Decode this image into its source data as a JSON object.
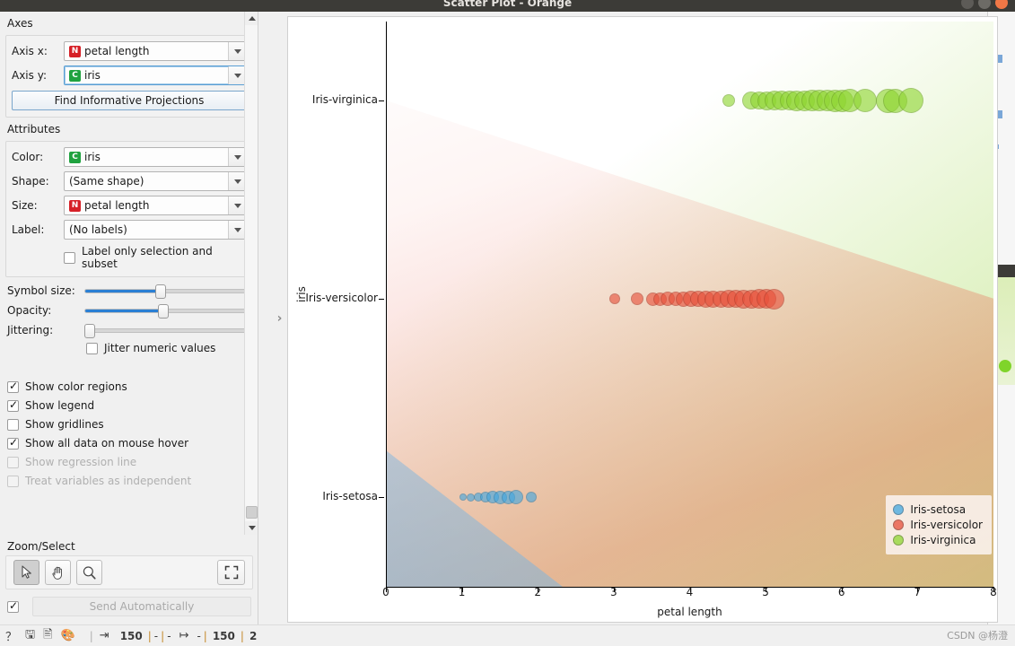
{
  "window": {
    "title": "Scatter Plot - Orange",
    "buttons": {
      "minimize": "minimize",
      "maximize": "maximize",
      "close": "close"
    }
  },
  "panel": {
    "axes": {
      "title": "Axes",
      "axis_x_label": "Axis x:",
      "axis_x_value": "petal length",
      "axis_x_type": "N",
      "axis_y_label": "Axis y:",
      "axis_y_value": "iris",
      "axis_y_type": "C",
      "find_projections_button": "Find Informative Projections"
    },
    "attributes": {
      "title": "Attributes",
      "color_label": "Color:",
      "color_value": "iris",
      "color_type": "C",
      "shape_label": "Shape:",
      "shape_value": "(Same shape)",
      "size_label": "Size:",
      "size_value": "petal length",
      "size_type": "N",
      "label_label": "Label:",
      "label_value": "(No labels)",
      "label_only_selection": "Label only selection and subset",
      "label_only_selection_checked": false
    },
    "sliders": {
      "symbol_size_label": "Symbol size:",
      "symbol_size_percent": 46,
      "opacity_label": "Opacity:",
      "opacity_percent": 48,
      "jittering_label": "Jittering:",
      "jittering_percent": 0,
      "jitter_numeric_label": "Jitter numeric values",
      "jitter_numeric_checked": false
    },
    "options": [
      {
        "label": "Show color regions",
        "checked": true,
        "disabled": false
      },
      {
        "label": "Show legend",
        "checked": true,
        "disabled": false
      },
      {
        "label": "Show gridlines",
        "checked": false,
        "disabled": false
      },
      {
        "label": "Show all data on mouse hover",
        "checked": true,
        "disabled": false
      },
      {
        "label": "Show regression line",
        "checked": false,
        "disabled": true
      },
      {
        "label": "Treat variables as independent",
        "checked": false,
        "disabled": true
      }
    ],
    "zoom_select": {
      "title": "Zoom/Select",
      "tools": [
        {
          "name": "select-tool",
          "icon": "cursor-icon",
          "active": true
        },
        {
          "name": "pan-tool",
          "icon": "hand-icon",
          "active": false
        },
        {
          "name": "zoom-tool",
          "icon": "magnifier-icon",
          "active": false
        }
      ],
      "reset_tool": {
        "name": "reset-zoom",
        "icon": "fit-icon"
      },
      "send_automatically_label": "Send Automatically",
      "send_automatically_checked": true
    }
  },
  "collapse_handle": "›",
  "statusbar": {
    "icons": [
      "help-icon",
      "save-icon",
      "report-icon",
      "palette-icon"
    ],
    "input_count": "150",
    "input_dash1": "-",
    "input_dash2": "-",
    "output_dash": "-",
    "output_count": "150",
    "output_selected": "2",
    "watermark": "CSDN @杨澄"
  },
  "chart_data": {
    "type": "scatter",
    "title": "",
    "xlabel": "petal length",
    "ylabel": "iris",
    "xlim": [
      0,
      8
    ],
    "xticks": [
      "0",
      "1",
      "2",
      "3",
      "4",
      "5",
      "6",
      "7",
      "8"
    ],
    "yticks": [
      "Iris-setosa",
      "Iris-versicolor",
      "Iris-virginica"
    ],
    "grid": false,
    "legend_position": "bottom-right",
    "color_regions": true,
    "colors": {
      "Iris-setosa": "#42a7e0",
      "Iris-versicolor": "#e8503a",
      "Iris-virginica": "#8fd631"
    },
    "series": [
      {
        "name": "Iris-setosa",
        "y": "Iris-setosa",
        "color": "#42a7e0",
        "points": [
          {
            "x": 1.0,
            "r": 4
          },
          {
            "x": 1.1,
            "r": 4.5
          },
          {
            "x": 1.2,
            "r": 5
          },
          {
            "x": 1.3,
            "r": 6
          },
          {
            "x": 1.4,
            "r": 7
          },
          {
            "x": 1.5,
            "r": 7.5
          },
          {
            "x": 1.6,
            "r": 7.5
          },
          {
            "x": 1.7,
            "r": 8
          },
          {
            "x": 1.9,
            "r": 6
          }
        ]
      },
      {
        "name": "Iris-versicolor",
        "y": "Iris-versicolor",
        "color": "#e8503a",
        "points": [
          {
            "x": 3.0,
            "r": 6
          },
          {
            "x": 3.3,
            "r": 7
          },
          {
            "x": 3.5,
            "r": 7.5
          },
          {
            "x": 3.6,
            "r": 7.5
          },
          {
            "x": 3.7,
            "r": 8
          },
          {
            "x": 3.8,
            "r": 8
          },
          {
            "x": 3.9,
            "r": 8.5
          },
          {
            "x": 4.0,
            "r": 9
          },
          {
            "x": 4.1,
            "r": 9
          },
          {
            "x": 4.2,
            "r": 9.5
          },
          {
            "x": 4.3,
            "r": 9.5
          },
          {
            "x": 4.4,
            "r": 9.5
          },
          {
            "x": 4.5,
            "r": 10
          },
          {
            "x": 4.6,
            "r": 10
          },
          {
            "x": 4.7,
            "r": 10.5
          },
          {
            "x": 4.8,
            "r": 10.5
          },
          {
            "x": 4.9,
            "r": 11
          },
          {
            "x": 5.0,
            "r": 11
          },
          {
            "x": 5.1,
            "r": 11.5
          }
        ]
      },
      {
        "name": "Iris-virginica",
        "y": "Iris-virginica",
        "color": "#8fd631",
        "points": [
          {
            "x": 4.5,
            "r": 7
          },
          {
            "x": 4.8,
            "r": 10
          },
          {
            "x": 4.9,
            "r": 10
          },
          {
            "x": 5.0,
            "r": 10.5
          },
          {
            "x": 5.1,
            "r": 11
          },
          {
            "x": 5.2,
            "r": 11
          },
          {
            "x": 5.3,
            "r": 11
          },
          {
            "x": 5.4,
            "r": 11.5
          },
          {
            "x": 5.5,
            "r": 11.5
          },
          {
            "x": 5.6,
            "r": 12
          },
          {
            "x": 5.7,
            "r": 12
          },
          {
            "x": 5.8,
            "r": 12
          },
          {
            "x": 5.9,
            "r": 12.5
          },
          {
            "x": 6.0,
            "r": 12.5
          },
          {
            "x": 6.1,
            "r": 13
          },
          {
            "x": 6.3,
            "r": 13
          },
          {
            "x": 6.6,
            "r": 13.5
          },
          {
            "x": 6.7,
            "r": 13.5
          },
          {
            "x": 6.9,
            "r": 14
          }
        ]
      }
    ],
    "legend_entries": [
      "Iris-setosa",
      "Iris-versicolor",
      "Iris-virginica"
    ]
  }
}
